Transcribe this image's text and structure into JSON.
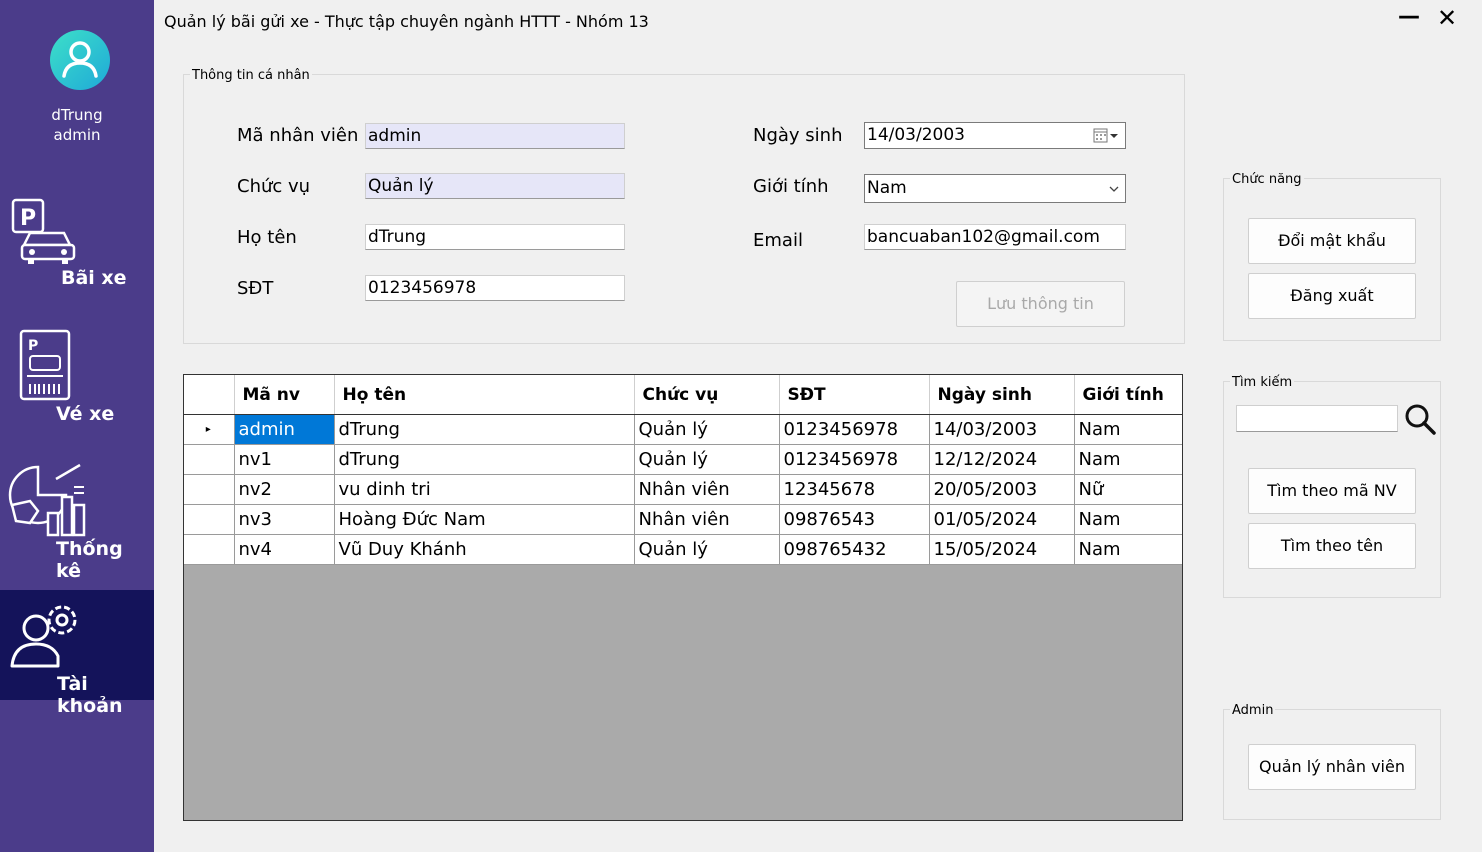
{
  "window": {
    "title": "Quản lý bãi gửi xe - Thực tập chuyên ngành HTTT - Nhóm 13",
    "minimize_glyph": "—",
    "close_glyph": "✕"
  },
  "sidebar": {
    "user": {
      "name": "dTrung",
      "role": "admin"
    },
    "items": [
      {
        "label": "Bãi xe",
        "icon": "parking-car-icon"
      },
      {
        "label": "Vé xe",
        "icon": "parking-ticket-icon"
      },
      {
        "label": "Thống kê",
        "icon": "statistics-icon"
      },
      {
        "label": "Tài khoản",
        "icon": "account-settings-icon",
        "active": true
      }
    ]
  },
  "personal": {
    "group_title": "Thông tin cá nhân",
    "ma_nv": {
      "label": "Mã nhân viên",
      "value": "admin"
    },
    "chuc_vu": {
      "label": "Chức vụ",
      "value": "Quản lý"
    },
    "ho_ten": {
      "label": "Họ tên",
      "value": "dTrung"
    },
    "sdt": {
      "label": "SĐT",
      "value": "0123456978"
    },
    "ngay_sinh": {
      "label": "Ngày sinh",
      "value": "14/03/2003"
    },
    "gioi_tinh": {
      "label": "Giới tính",
      "value": "Nam"
    },
    "email": {
      "label": "Email",
      "value": "bancuaban102@gmail.com"
    },
    "save_label": "Lưu thông tin"
  },
  "grid": {
    "columns": [
      "Mã nv",
      "Họ tên",
      "Chức vụ",
      "SĐT",
      "Ngày sinh",
      "Giới tính"
    ],
    "current_row_glyph": "▸",
    "rows": [
      [
        "admin",
        "dTrung",
        "Quản lý",
        "0123456978",
        "14/03/2003",
        "Nam"
      ],
      [
        "nv1",
        "dTrung",
        "Quản lý",
        "0123456978",
        "12/12/2024",
        "Nam"
      ],
      [
        "nv2",
        "vu dinh tri",
        "Nhân viên",
        "12345678",
        "20/05/2003",
        "Nữ"
      ],
      [
        "nv3",
        "Hoàng Đức Nam",
        "Nhân viên",
        "09876543",
        "01/05/2024",
        "Nam"
      ],
      [
        "nv4",
        "Vũ Duy Khánh",
        "Quản lý",
        "098765432",
        "15/05/2024",
        "Nam"
      ]
    ]
  },
  "chuc_nang": {
    "title": "Chức năng",
    "change_password": "Đổi mật khẩu",
    "logout": "Đăng xuất"
  },
  "search": {
    "title": "Tìm kiếm",
    "query": "",
    "by_id": "Tìm theo mã NV",
    "by_name": "Tìm theo tên"
  },
  "admin": {
    "title": "Admin",
    "manage_staff": "Quản lý nhân viên"
  },
  "colors": {
    "sidebar": "#4b3c8a",
    "sidebar_active": "#14135a",
    "selection": "#0078d7",
    "readonly_field": "#e6e6f8"
  }
}
